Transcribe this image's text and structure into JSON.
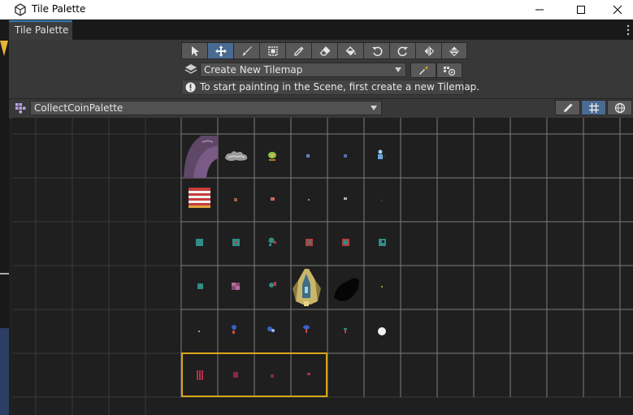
{
  "window": {
    "title": "Tile Palette",
    "icon": "unity-logo-icon"
  },
  "window_controls": [
    "minimize-icon",
    "maximize-icon",
    "close-icon"
  ],
  "tab": {
    "label": "Tile Palette"
  },
  "toolbar": {
    "tools": [
      {
        "name": "select-tool",
        "icon": "arrow-cursor-icon",
        "active": false
      },
      {
        "name": "move-tool",
        "icon": "move-arrows-icon",
        "active": true
      },
      {
        "name": "paint-tool",
        "icon": "brush-icon",
        "active": false
      },
      {
        "name": "box-fill-tool",
        "icon": "box-fill-icon",
        "active": false
      },
      {
        "name": "picker-tool",
        "icon": "eyedropper-icon",
        "active": false
      },
      {
        "name": "erase-tool",
        "icon": "eraser-icon",
        "active": false
      },
      {
        "name": "flood-fill-tool",
        "icon": "paint-bucket-icon",
        "active": false
      },
      {
        "name": "rotate-ccw-tool",
        "icon": "rotate-left-icon",
        "active": false
      },
      {
        "name": "rotate-cw-tool",
        "icon": "rotate-right-icon",
        "active": false
      },
      {
        "name": "flip-x-tool",
        "icon": "flip-horizontal-icon",
        "active": false
      },
      {
        "name": "flip-y-tool",
        "icon": "flip-vertical-icon",
        "active": false
      }
    ]
  },
  "active_tilemap": {
    "value": "Create New Tilemap"
  },
  "notice": {
    "text": "To start painting in the Scene, first create a new Tilemap."
  },
  "palette": {
    "selected": "CollectCoinPalette"
  },
  "palette_tools": [
    {
      "name": "edit-palette-button",
      "icon": "pencil-icon",
      "active": false
    },
    {
      "name": "grid-toggle-button",
      "icon": "grid-icon",
      "active": true
    },
    {
      "name": "gizmos-button",
      "icon": "gizmo-globe-icon",
      "active": false
    }
  ],
  "accent": "#3a79bb",
  "selection_color": "#d8a61a"
}
